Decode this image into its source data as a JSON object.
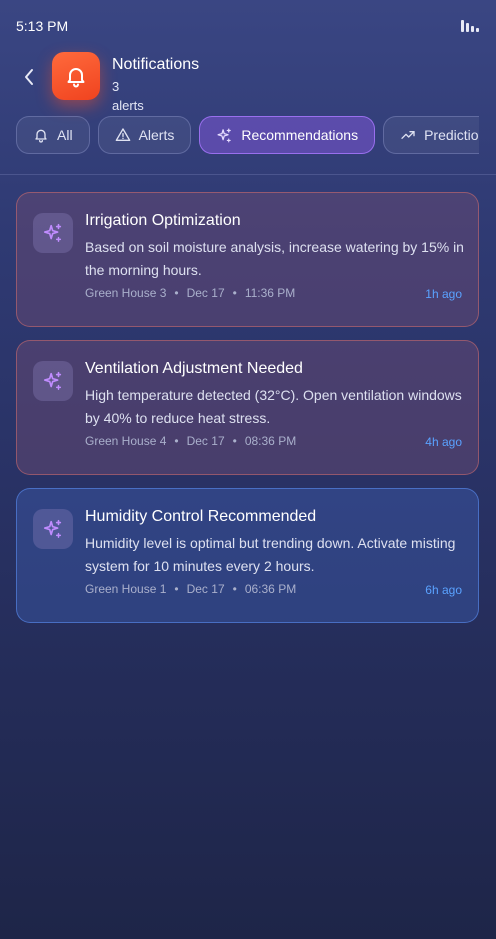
{
  "status_bar": {
    "time": "5:13 PM",
    "signal_icon": "signal-bars-icon"
  },
  "header": {
    "back_icon": "chevron-left-icon",
    "app_icon": "bell-icon",
    "title": "Notifications",
    "count": "3",
    "count_suffix": "alerts"
  },
  "tabs": [
    {
      "label": "All",
      "icon": "bell-icon",
      "active": false
    },
    {
      "label": "Alerts",
      "icon": "warning-triangle-icon",
      "active": false
    },
    {
      "label": "Recommendations",
      "icon": "sparkles-icon",
      "active": true
    },
    {
      "label": "Predictions",
      "icon": "trending-up-icon",
      "active": false
    }
  ],
  "notifications": [
    {
      "title": "Irrigation Optimization",
      "body": "Based on soil moisture analysis, increase watering by 15% in the morning hours.",
      "location": "Green House 3",
      "date": "Dec 17",
      "time": "11:36 PM",
      "ago": "1h ago",
      "icon": "sparkles-icon",
      "tone": "warm"
    },
    {
      "title": "Ventilation Adjustment Needed",
      "body": "High temperature detected (32°C). Open ventilation windows by 40% to reduce heat stress.",
      "location": "Green House 4",
      "date": "Dec 17",
      "time": "08:36 PM",
      "ago": "4h ago",
      "icon": "sparkles-icon",
      "tone": "warm"
    },
    {
      "title": "Humidity Control Recommended",
      "body": "Humidity level is optimal but trending down. Activate misting system for 10 minutes every 2 hours.",
      "location": "Green House 1",
      "date": "Dec 17",
      "time": "06:36 PM",
      "ago": "6h ago",
      "icon": "sparkles-icon",
      "tone": "cool"
    }
  ],
  "colors": {
    "accent": "#8c5ae6",
    "brand": "#f0431f",
    "time_link": "#5aa2ff",
    "warm_border": "#d26e6e",
    "cool_border": "#5a8cf0",
    "sparkle": "#c08cff"
  }
}
